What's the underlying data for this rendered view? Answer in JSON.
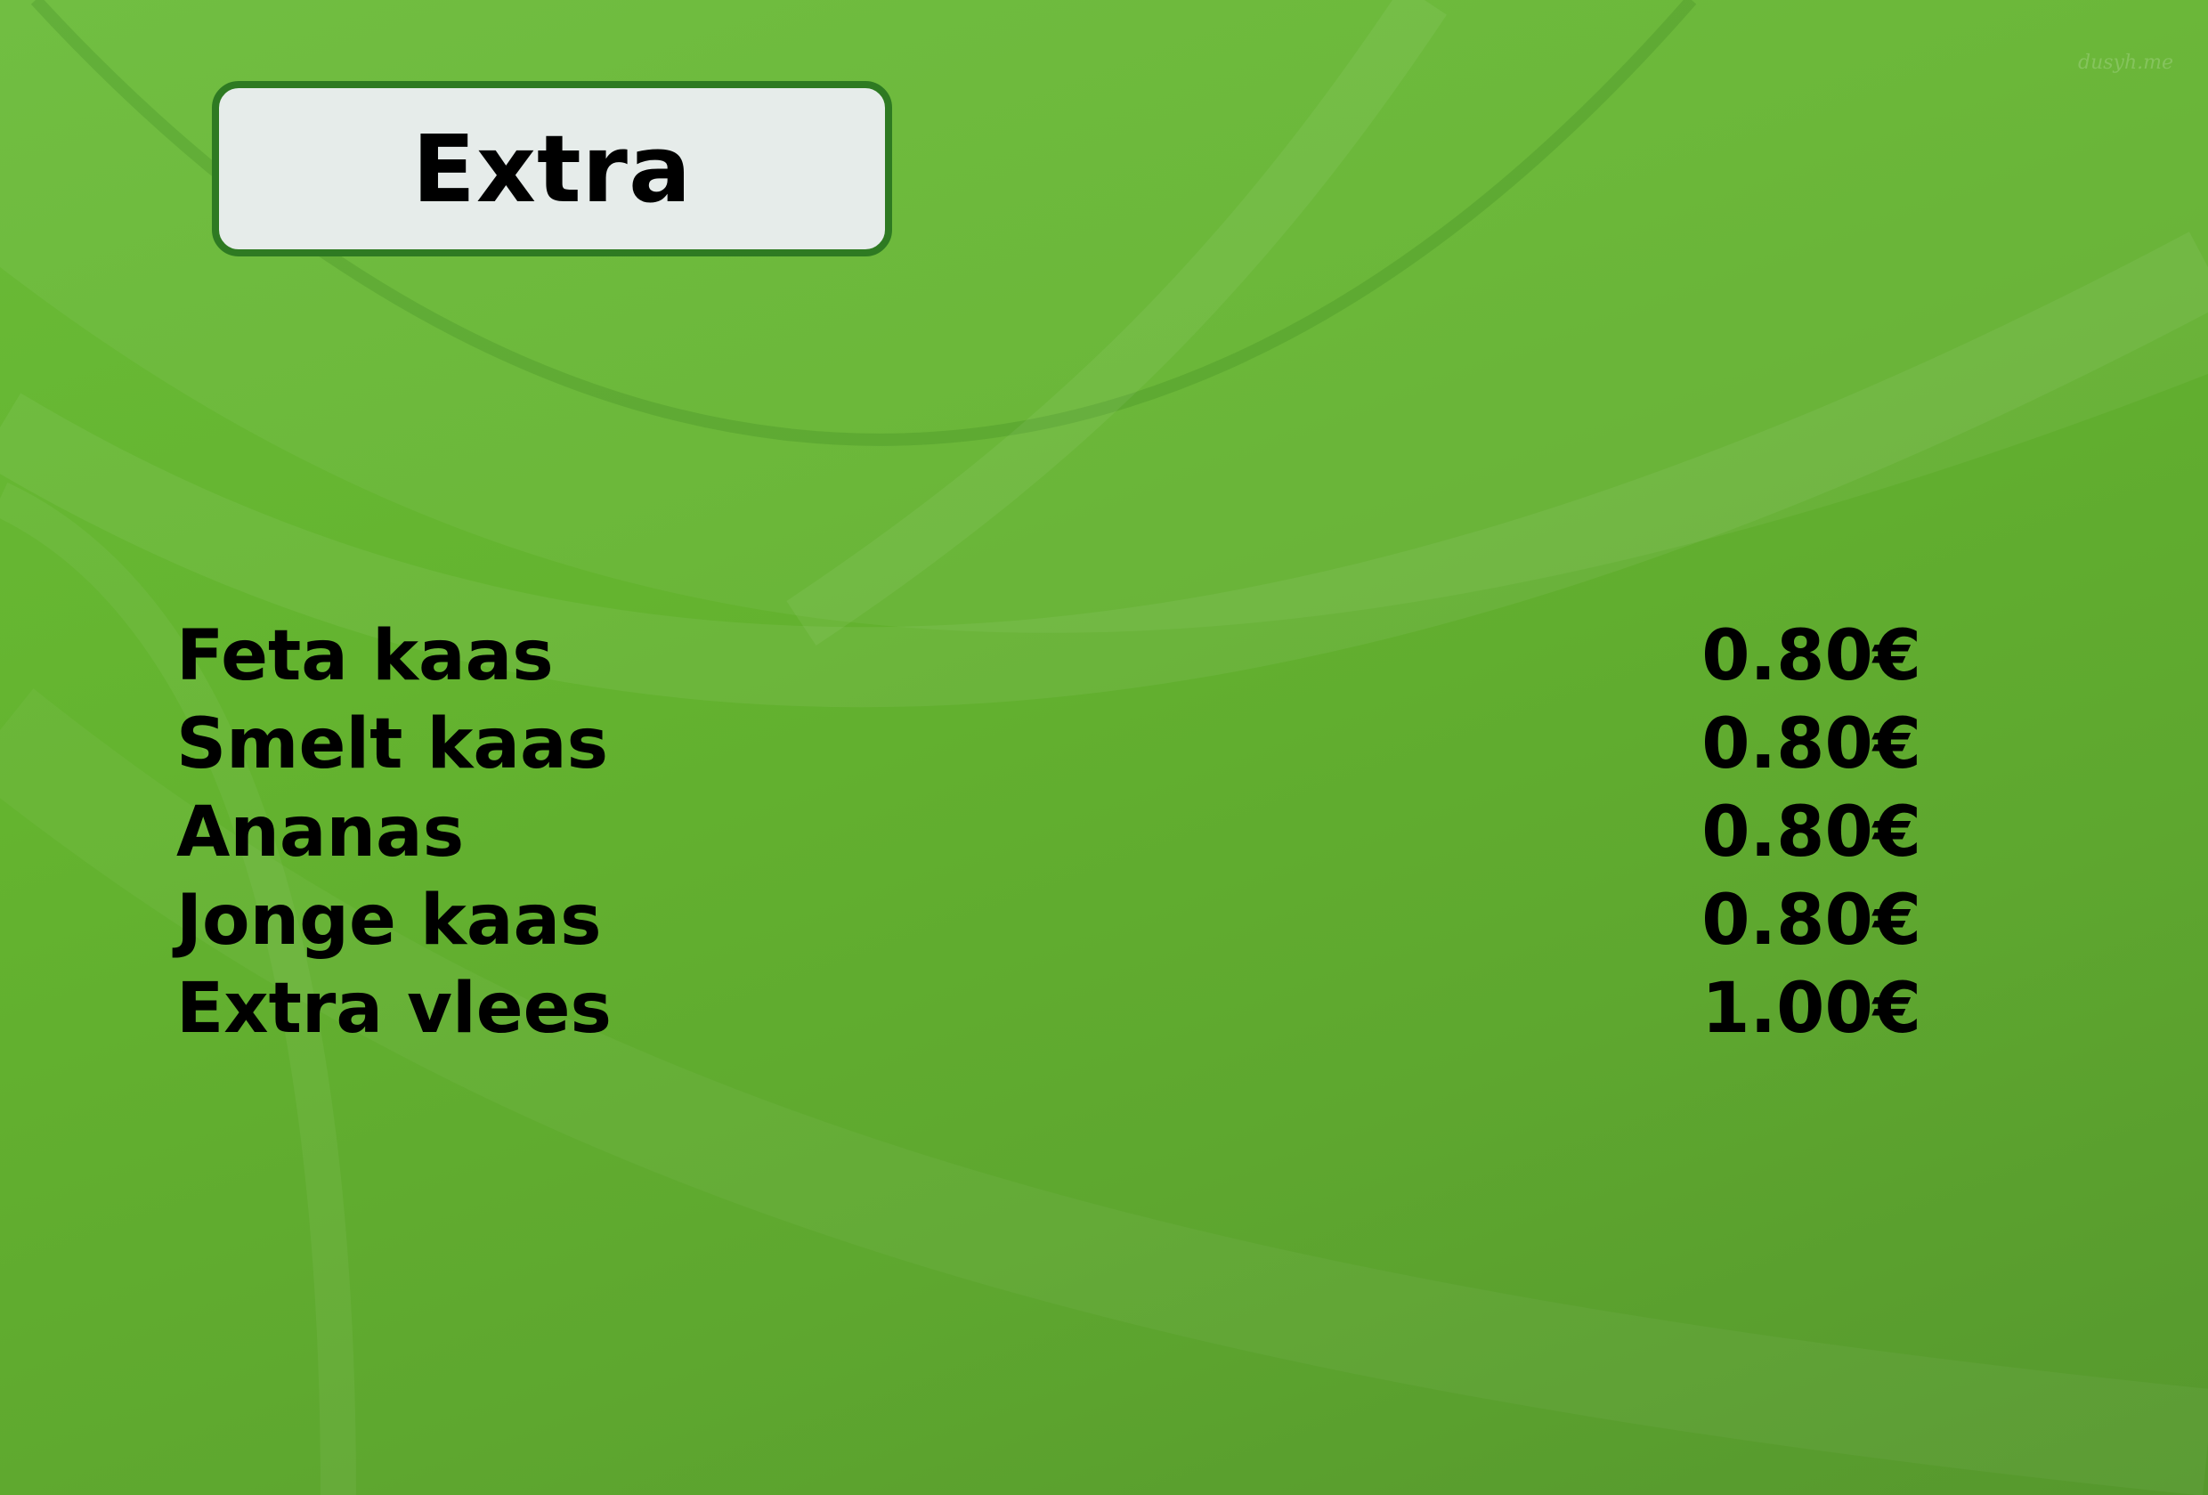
{
  "header": {
    "title": "Extra"
  },
  "menu": {
    "items": [
      {
        "name": "Feta kaas",
        "price": "0.80€"
      },
      {
        "name": "Smelt kaas",
        "price": "0.80€"
      },
      {
        "name": "Ananas",
        "price": "0.80€"
      },
      {
        "name": "Jonge kaas",
        "price": "0.80€"
      },
      {
        "name": "Extra vlees",
        "price": "1.00€"
      }
    ]
  },
  "watermark": {
    "text": "dusyh.me"
  },
  "colors": {
    "background": "#64b42f",
    "title_box_fill": "#e6ecea",
    "title_box_border": "#2e7a22",
    "text": "#000000"
  }
}
